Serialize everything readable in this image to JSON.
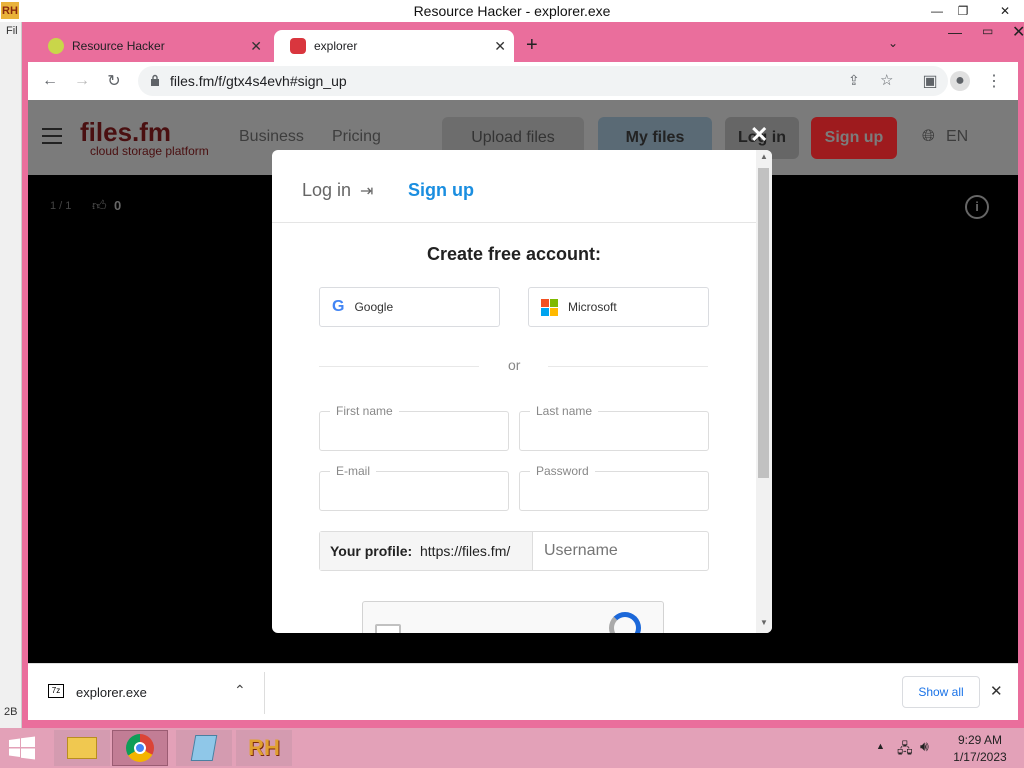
{
  "app": {
    "window_title": "Resource Hacker - explorer.exe",
    "logo_text": "RH",
    "left_menu_fragment": "Fil",
    "left_bottom_code": "2B"
  },
  "browser": {
    "tabs": [
      {
        "label": "Resource Hacker",
        "active": false
      },
      {
        "label": "explorer",
        "active": true
      }
    ],
    "new_tab_icon": "plus-icon",
    "url": "files.fm/f/gtx4s4evh#sign_up"
  },
  "site": {
    "logo_name": "files.fm",
    "logo_tagline": "cloud storage platform",
    "nav": [
      "Business",
      "Pricing"
    ],
    "upload_label": "Upload files",
    "myfiles_label": "My files",
    "login_label": "Log in",
    "signup_label": "Sign up",
    "lang_label": "EN",
    "viewer_counter": "1 / 1",
    "like_count": "0"
  },
  "modal": {
    "tab_login": "Log in",
    "tab_signup": "Sign up",
    "heading": "Create free account:",
    "google_label": "Google",
    "microsoft_label": "Microsoft",
    "or_label": "or",
    "first_name_label": "First name",
    "last_name_label": "Last name",
    "email_label": "E-mail",
    "password_label": "Password",
    "profile_label": "Your profile:",
    "profile_prefix": "https://files.fm/",
    "username_placeholder": "Username"
  },
  "downloads": {
    "file_name": "explorer.exe",
    "show_all": "Show all"
  },
  "taskbar": {
    "time": "9:29 AM",
    "date": "1/17/2023"
  },
  "colors": {
    "chrome_frame": "#ea6e9c",
    "signup_accent": "#1a8ee0",
    "signup_btn": "#9e1b1e"
  }
}
